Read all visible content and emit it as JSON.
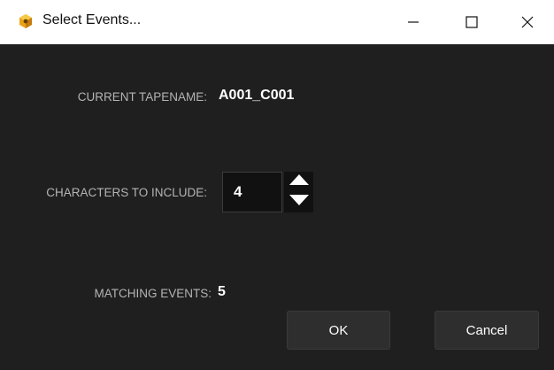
{
  "window": {
    "title": "Select Events...",
    "app_icon": "resolve-cube-icon",
    "controls": [
      "minimize-icon",
      "maximize-icon",
      "close-icon"
    ]
  },
  "fields": {
    "tapename_label": "CURRENT TAPENAME:",
    "tapename_value": "A001_C001",
    "chars_label": "CHARACTERS TO INCLUDE:",
    "chars_value": "4",
    "matching_label": "MATCHING EVENTS:",
    "matching_value": "5"
  },
  "buttons": {
    "ok": "OK",
    "cancel": "Cancel"
  },
  "colors": {
    "dialog_bg": "#1f1f1f",
    "titlebar_bg": "#ffffff",
    "label": "#b4b4b4",
    "value": "#ffffff",
    "button_bg": "#2e2e2e"
  }
}
